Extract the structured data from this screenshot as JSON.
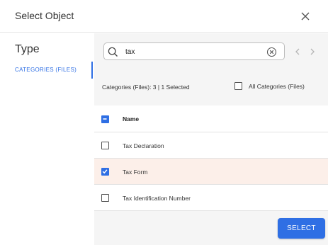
{
  "dialog": {
    "title": "Select Object",
    "close_icon": "close-icon"
  },
  "sidebar": {
    "heading": "Type",
    "tab_label": "CATEGORIES (FILES)"
  },
  "search": {
    "value": "tax",
    "search_icon": "search-icon",
    "clear_icon": "clear-circle-icon"
  },
  "pagination": {
    "prev_icon": "chevron-left-icon",
    "next_icon": "chevron-right-icon"
  },
  "summary": {
    "count_text": "Categories (Files): 3 | 1 Selected",
    "all_label": "All Categories (Files)",
    "all_checked": false
  },
  "table": {
    "column_name": "Name",
    "header_state": "indeterminate",
    "rows": [
      {
        "label": "Tax Declaration",
        "checked": false
      },
      {
        "label": "Tax Form",
        "checked": true
      },
      {
        "label": "Tax Identification Number",
        "checked": false
      }
    ]
  },
  "actions": {
    "select_label": "SELECT"
  },
  "colors": {
    "accent": "#2f6fe4",
    "selected_row": "#fcefe9",
    "pane_bg": "#f5f5f5"
  }
}
